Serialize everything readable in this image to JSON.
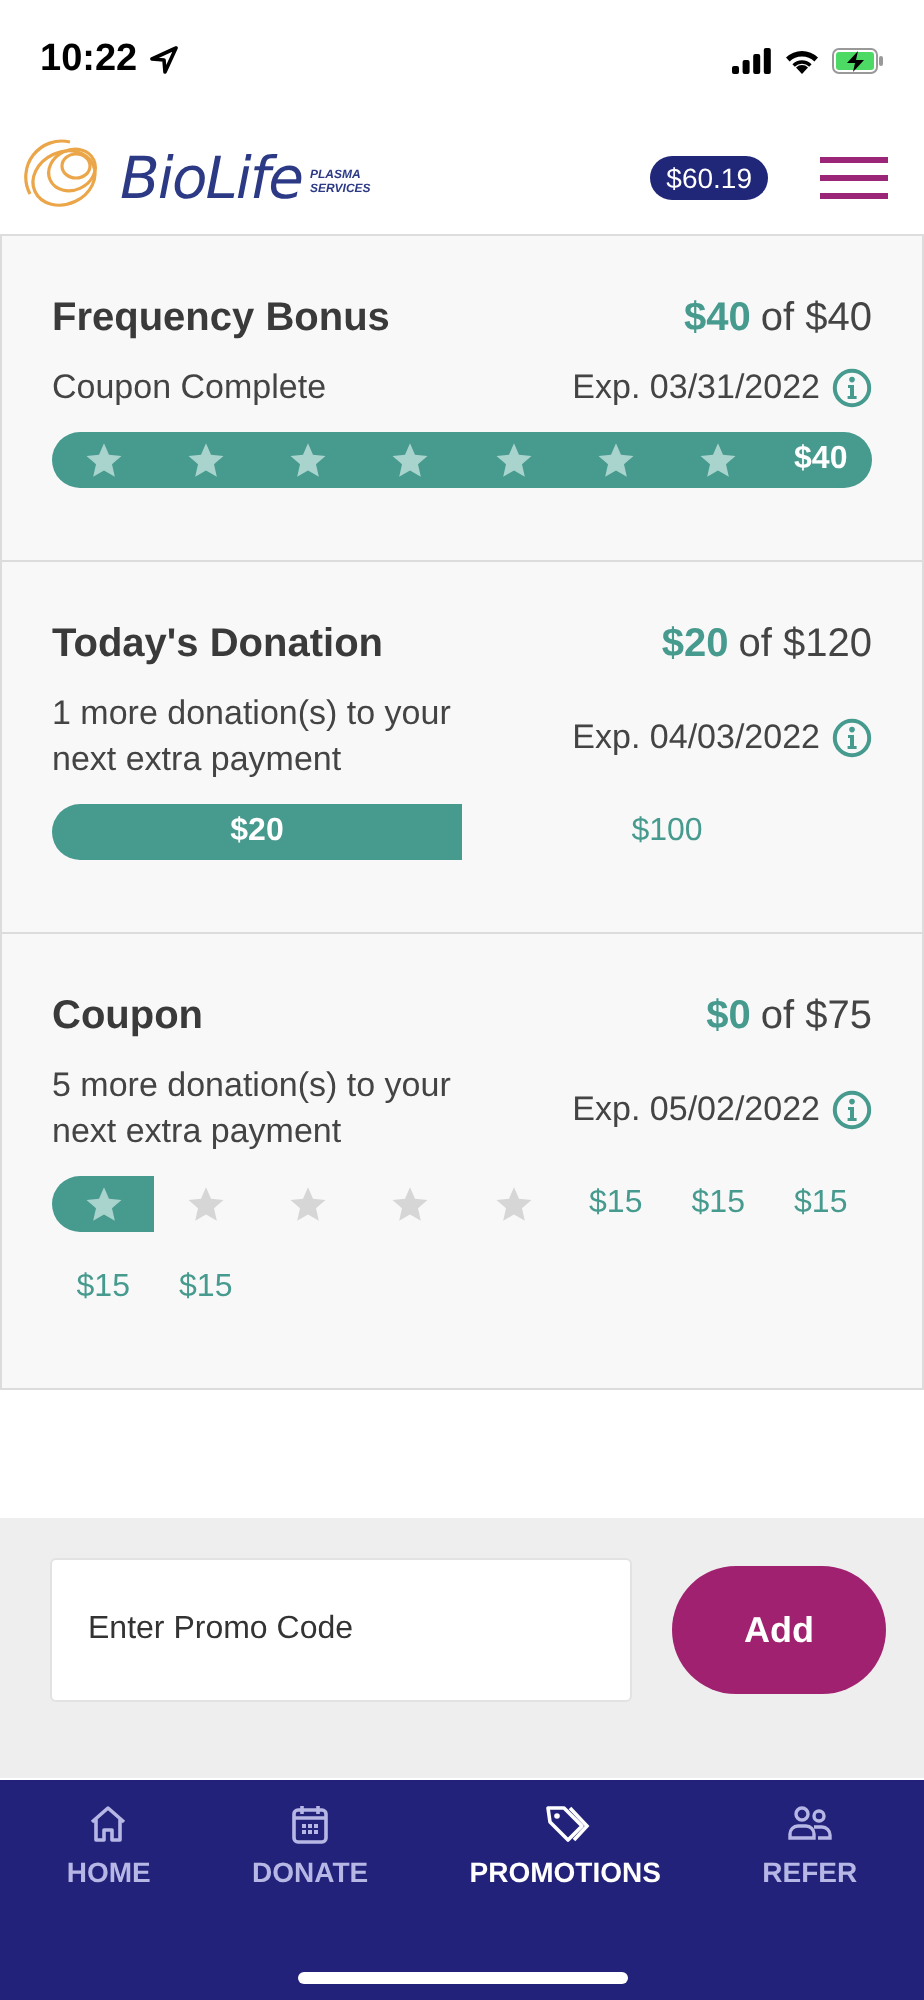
{
  "status_bar": {
    "time": "10:22"
  },
  "header": {
    "brand": "BioLife",
    "brand_sub": "PLASMA SERVICES",
    "balance": "$60.19"
  },
  "promotions": [
    {
      "kind": "steps",
      "title": "Frequency Bonus",
      "earned": "$40",
      "of_total": "of $40",
      "subtitle": "Coupon Complete",
      "expiry": "Exp. 03/31/2022",
      "steps": [
        {
          "kind": "star",
          "filled": true
        },
        {
          "kind": "star",
          "filled": true
        },
        {
          "kind": "star",
          "filled": true
        },
        {
          "kind": "star",
          "filled": true
        },
        {
          "kind": "star",
          "filled": true
        },
        {
          "kind": "star",
          "filled": true
        },
        {
          "kind": "star",
          "filled": true
        },
        {
          "kind": "amount",
          "label": "$40",
          "filled": true
        }
      ]
    },
    {
      "kind": "bar",
      "title": "Today's Donation",
      "earned": "$20",
      "of_total": "of $120",
      "subtitle": "1 more donation(s) to your next extra payment",
      "expiry": "Exp. 04/03/2022",
      "fill_label": "$20",
      "rest_label": "$100"
    },
    {
      "kind": "steps",
      "title": "Coupon",
      "earned": "$0",
      "of_total": "of $75",
      "subtitle": "5 more donation(s) to your next extra payment",
      "expiry": "Exp. 05/02/2022",
      "steps": [
        {
          "kind": "star",
          "filled": true
        },
        {
          "kind": "star",
          "filled": false
        },
        {
          "kind": "star",
          "filled": false
        },
        {
          "kind": "star",
          "filled": false
        },
        {
          "kind": "star",
          "filled": false
        },
        {
          "kind": "amount",
          "label": "$15",
          "filled": false
        },
        {
          "kind": "amount",
          "label": "$15",
          "filled": false
        },
        {
          "kind": "amount",
          "label": "$15",
          "filled": false
        },
        {
          "kind": "amount",
          "label": "$15",
          "filled": false
        },
        {
          "kind": "amount",
          "label": "$15",
          "filled": false
        }
      ]
    }
  ],
  "promo_code": {
    "placeholder": "Enter Promo Code",
    "button": "Add"
  },
  "nav": [
    {
      "kind": "home",
      "label": "HOME",
      "selected": false
    },
    {
      "kind": "calendar",
      "label": "DONATE",
      "selected": false
    },
    {
      "kind": "tag",
      "label": "PROMOTIONS",
      "selected": true
    },
    {
      "kind": "people",
      "label": "REFER",
      "selected": false
    }
  ]
}
